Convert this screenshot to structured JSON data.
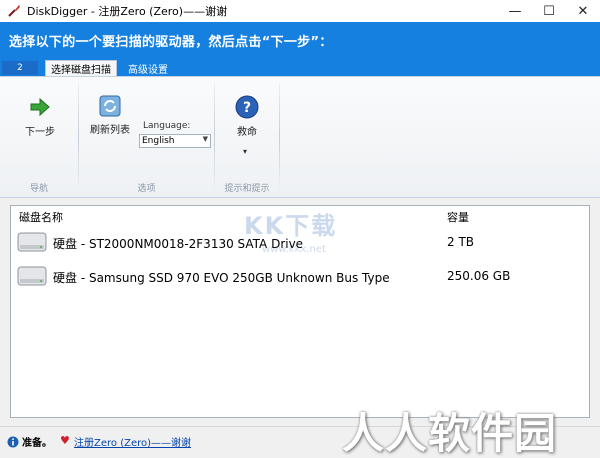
{
  "window": {
    "title": "DiskDigger - 注册Zero (Zero)——谢谢",
    "controls": {
      "minimize": "—",
      "maximize": "☐",
      "close": "✕"
    }
  },
  "banner": {
    "text": "选择以下的一个要扫描的驱动器，然后点击“下一步”："
  },
  "ribbon": {
    "file_tab": "2",
    "tabs": [
      {
        "label": "选择磁盘扫描",
        "active": true
      },
      {
        "label": "高级设置",
        "active": false
      }
    ],
    "groups": {
      "nav": {
        "label": "导航",
        "next_label": "下一步"
      },
      "options": {
        "label": "选项",
        "refresh_label": "刷新列表",
        "language_label": "Language:",
        "language_value": "English"
      },
      "help": {
        "label": "提示和提示",
        "help_label": "救命"
      }
    },
    "icons": {
      "next": "arrow-right-icon",
      "refresh": "refresh-icon",
      "help": "help-icon"
    }
  },
  "list": {
    "columns": {
      "name": "磁盘名称",
      "size": "容量"
    },
    "rows": [
      {
        "name": "硬盘 - ST2000NM0018-2F3130 SATA Drive",
        "size": "2 TB",
        "icon": "hard-drive-icon"
      },
      {
        "name": "硬盘 - Samsung SSD 970 EVO 250GB Unknown Bus Type",
        "size": "250.06 GB",
        "icon": "hard-drive-icon"
      }
    ]
  },
  "watermarks": {
    "center": "KK下载",
    "url": "www.kkx.net",
    "corner": "人人软件园"
  },
  "status": {
    "text": "准备。",
    "link": "注册Zero (Zero)——谢谢"
  },
  "colors": {
    "banner": "#1680e0",
    "link": "#0645ad",
    "heart": "#d0202a"
  }
}
